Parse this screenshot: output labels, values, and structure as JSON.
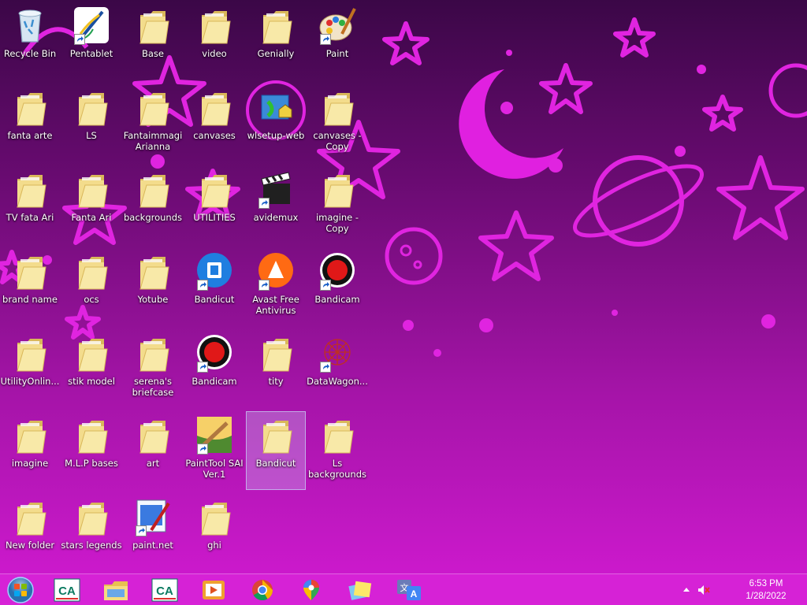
{
  "desktop": {
    "icons": [
      {
        "label": "Recycle Bin",
        "icon": "recycle-bin-icon"
      },
      {
        "label": "Pentablet",
        "icon": "pentablet-icon"
      },
      {
        "label": "Base",
        "icon": "folder-icon"
      },
      {
        "label": "video",
        "icon": "folder-icon"
      },
      {
        "label": "Genially",
        "icon": "folder-icon"
      },
      {
        "label": "Paint",
        "icon": "paint-icon"
      },
      {
        "label": "fanta arte",
        "icon": "folder-icon"
      },
      {
        "label": "LS",
        "icon": "folder-icon"
      },
      {
        "label": "Fantaimmagi Arianna",
        "icon": "folder-icon"
      },
      {
        "label": "canvases",
        "icon": "folder-icon"
      },
      {
        "label": "wlsetup-web",
        "icon": "installer-icon"
      },
      {
        "label": "canvases - Copy",
        "icon": "folder-icon"
      },
      {
        "label": "TV  fata Ari",
        "icon": "folder-icon"
      },
      {
        "label": "Fanta Ari",
        "icon": "folder-icon"
      },
      {
        "label": "backgrounds",
        "icon": "folder-icon"
      },
      {
        "label": "UTILITIES",
        "icon": "folder-icon"
      },
      {
        "label": "avidemux",
        "icon": "clapperboard-icon"
      },
      {
        "label": "imagine - Copy",
        "icon": "folder-icon"
      },
      {
        "label": "brand name",
        "icon": "folder-icon"
      },
      {
        "label": "ocs",
        "icon": "folder-icon"
      },
      {
        "label": "Yotube",
        "icon": "folder-icon"
      },
      {
        "label": "Bandicut",
        "icon": "bandicut-icon"
      },
      {
        "label": "Avast Free Antivirus",
        "icon": "avast-icon"
      },
      {
        "label": "Bandicam",
        "icon": "bandicam-icon"
      },
      {
        "label": "UtilityOnlin...",
        "icon": "folder-icon"
      },
      {
        "label": "stik  model",
        "icon": "folder-icon"
      },
      {
        "label": "serena's briefcase",
        "icon": "folder-icon"
      },
      {
        "label": "Bandicam",
        "icon": "bandicam-icon"
      },
      {
        "label": "tity",
        "icon": "folder-icon"
      },
      {
        "label": "DataWagon...",
        "icon": "datawagon-icon"
      },
      {
        "label": "imagine",
        "icon": "folder-icon"
      },
      {
        "label": "M.L.P bases",
        "icon": "folder-icon"
      },
      {
        "label": "art",
        "icon": "folder-icon"
      },
      {
        "label": "PaintTool SAI Ver.1",
        "icon": "painttool-sai-icon"
      },
      {
        "label": "Bandicut",
        "icon": "folder-icon"
      },
      {
        "label": "Ls backgrounds",
        "icon": "folder-icon"
      },
      {
        "label": "New folder",
        "icon": "folder-icon"
      },
      {
        "label": "stars legends",
        "icon": "folder-icon"
      },
      {
        "label": "paint.net",
        "icon": "paint-net-icon"
      },
      {
        "label": "ghi",
        "icon": "folder-icon"
      }
    ]
  },
  "taskbar": {
    "start": "windows-start-icon",
    "pinned": [
      {
        "name": "credit-agricole-icon"
      },
      {
        "name": "file-explorer-icon"
      },
      {
        "name": "credit-agricole-icon"
      },
      {
        "name": "video-player-icon"
      },
      {
        "name": "chrome-icon"
      },
      {
        "name": "maps-icon"
      },
      {
        "name": "sticky-notes-icon"
      },
      {
        "name": "translate-icon"
      }
    ],
    "tray": {
      "show_hidden": "chevron-up-icon",
      "volume": "volume-muted-icon",
      "time": "6:53 PM",
      "date": "1/28/2022"
    }
  },
  "colors": {
    "wallpaper_top": "#3b0747",
    "wallpaper_bottom": "#d21ad2",
    "star_pink": "#e020e0",
    "taskbar": "#d622d6"
  }
}
